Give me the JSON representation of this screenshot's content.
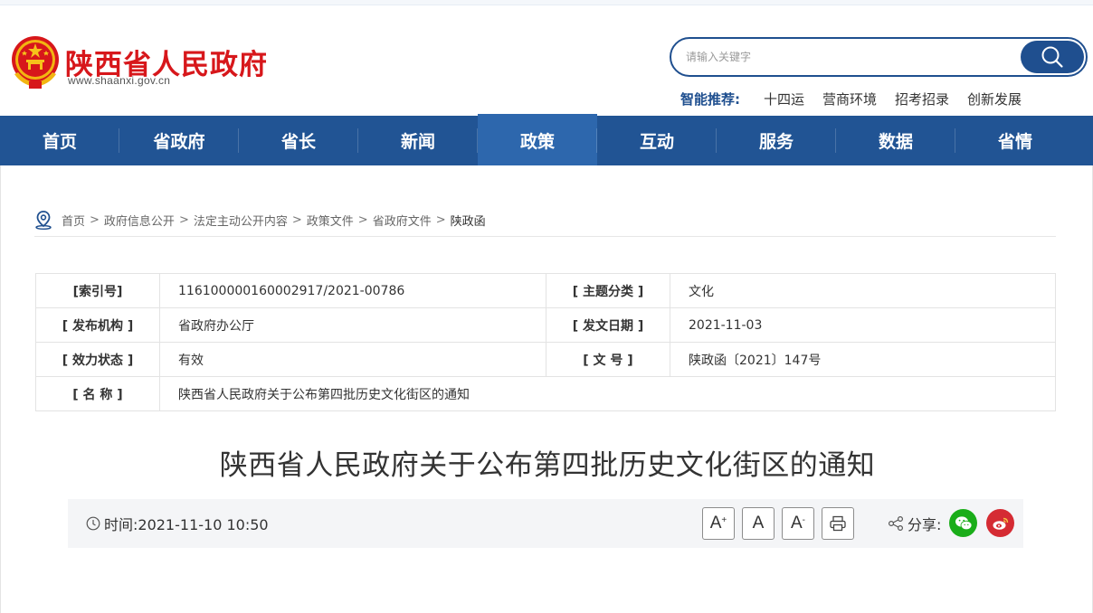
{
  "header": {
    "site_title": "陕西省人民政府",
    "site_domain": "www.shaanxi.gov.cn"
  },
  "search": {
    "placeholder": "请输入关键字"
  },
  "smart_recommend": {
    "label": "智能推荐:",
    "links": [
      "十四运",
      "营商环境",
      "招考招录",
      "创新发展"
    ]
  },
  "nav": {
    "items": [
      "首页",
      "省政府",
      "省长",
      "新闻",
      "政策",
      "互动",
      "服务",
      "数据",
      "省情"
    ],
    "active": "政策"
  },
  "breadcrumb": {
    "items": [
      "首页",
      "政府信息公开",
      "法定主动公开内容",
      "政策文件",
      "省政府文件"
    ],
    "current": "陕政函",
    "separator": ">"
  },
  "meta": {
    "index_label": "[索引号]",
    "index_value": "116100000160002917/2021-00786",
    "topic_label": "[ 主题分类 ]",
    "topic_value": "文化",
    "issuer_label": "[ 发布机构 ]",
    "issuer_value": "省政府办公厅",
    "date_label": "[ 发文日期 ]",
    "date_value": "2021-11-03",
    "status_label": "[ 效力状态 ]",
    "status_value": "有效",
    "docno_label": "[ 文 号 ]",
    "docno_value": "陕政函〔2021〕147号",
    "name_label": "[ 名 称 ]",
    "name_value": "陕西省人民政府关于公布第四批历史文化街区的通知"
  },
  "article": {
    "title": "陕西省人民政府关于公布第四批历史文化街区的通知",
    "time": "时间:2021-11-10 10:50"
  },
  "tools": {
    "font_large": "A",
    "font_normal": "A",
    "font_small": "A",
    "share_label": "分享:"
  },
  "colors": {
    "brand_red": "#d7171b",
    "nav_blue": "#215494",
    "nav_active": "#2d67ad",
    "wechat_green": "#1aad19",
    "weibo_red": "#d52b33"
  }
}
